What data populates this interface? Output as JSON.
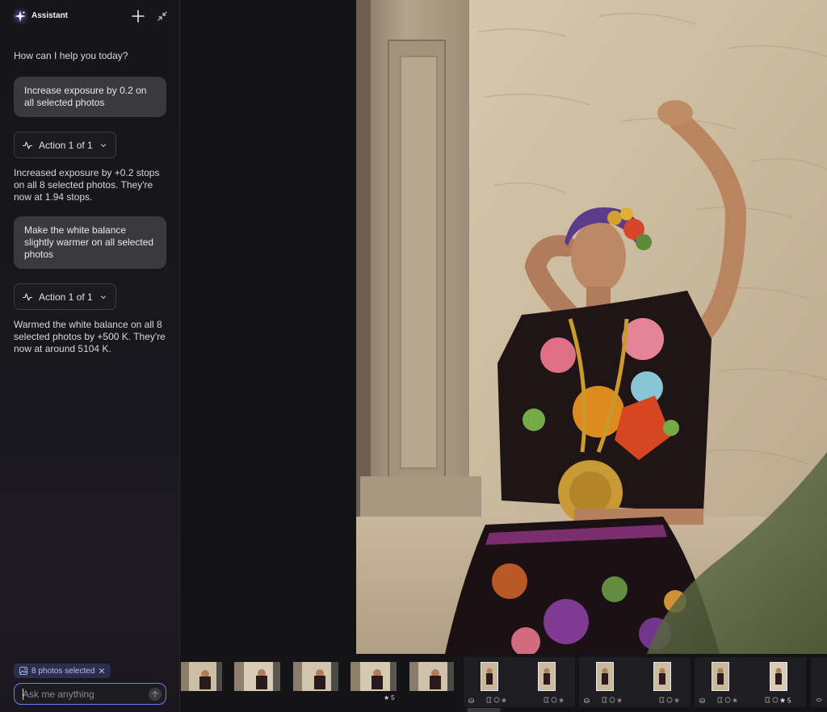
{
  "assistant": {
    "title": "Assistant",
    "greeting": "How can I help you today?",
    "messages": [
      {
        "user": "Increase exposure by 0.2 on all selected photos",
        "action_label": "Action 1 of 1",
        "reply": "Increased exposure by +0.2 stops on all 8 selected photos. They're now at 1.94 stops."
      },
      {
        "user": "Make the white balance slightly warmer on all selected photos",
        "action_label": "Action 1 of 1",
        "reply": "Warmed the white balance on all 8 selected photos by +500 K. They're now at around 5104 K."
      }
    ],
    "selection_chip": "8 photos selected",
    "input_placeholder": "Ask me anything",
    "accent": "#6b7cff"
  },
  "filmstrip": {
    "rating_label": "5",
    "rated_thumbnail_ratings": [
      "5",
      "5"
    ]
  }
}
